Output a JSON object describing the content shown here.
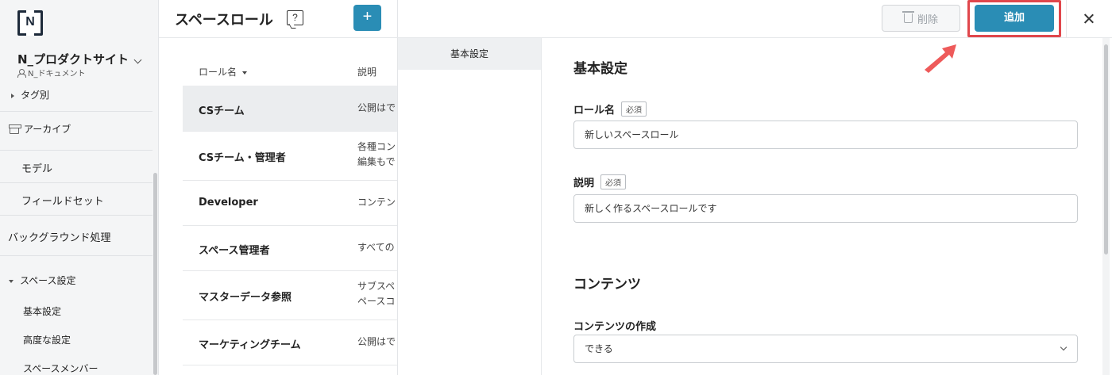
{
  "sidebar": {
    "logo_letter": "N",
    "site_name": "N_プロダクトサイト",
    "site_sub": "N_ドキュメント",
    "items": {
      "tags": "タグ別",
      "archive": "アーカイブ",
      "model": "モデル",
      "fieldset": "フィールドセット",
      "background": "バックグラウンド処理",
      "space_settings": "スペース設定",
      "basic": "基本設定",
      "advanced": "高度な設定",
      "members": "スペースメンバー"
    }
  },
  "list": {
    "title": "スペースロール",
    "add_label": "+",
    "help_label": "?",
    "columns": {
      "name": "ロール名",
      "desc": "説明"
    },
    "rows": [
      {
        "name": "CSチーム",
        "desc": "公開はで"
      },
      {
        "name": "CSチーム・管理者",
        "desc": "各種コン",
        "desc2": "編集もで"
      },
      {
        "name": "Developer",
        "desc": "コンテン"
      },
      {
        "name": "スペース管理者",
        "desc": "すべての"
      },
      {
        "name": "マスターデータ参照",
        "desc": "サブスペ",
        "desc2": "ペースコ"
      },
      {
        "name": "マーケティングチーム",
        "desc": "公開はで"
      }
    ]
  },
  "drawer": {
    "delete_label": "削除",
    "add_label": "追加",
    "nav": {
      "basic": "基本設定"
    },
    "section_basic": "基本設定",
    "role_name_label": "ロール名",
    "required_label": "必須",
    "role_name_value": "新しいスペースロール",
    "desc_label": "説明",
    "desc_value": "新しく作るスペースロールです",
    "section_content": "コンテンツ",
    "content_create_label": "コンテンツの作成",
    "content_create_value": "できる"
  },
  "colors": {
    "accent": "#2a8db5",
    "highlight": "#e0474c"
  }
}
